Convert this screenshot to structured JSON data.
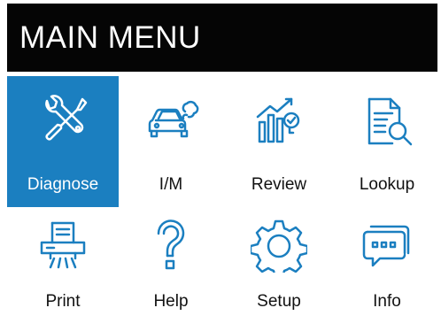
{
  "header": {
    "title": "MAIN MENU"
  },
  "colors": {
    "header_bg": "#050505",
    "accent": "#1b7fc0",
    "icon_color": "#1b7fc0",
    "icon_active": "#ffffff"
  },
  "menu": {
    "items": [
      {
        "label": "Diagnose",
        "icon": "wrench-screwdriver-icon",
        "selected": true
      },
      {
        "label": "I/M",
        "icon": "car-exhaust-icon",
        "selected": false
      },
      {
        "label": "Review",
        "icon": "bar-chart-icon",
        "selected": false
      },
      {
        "label": "Lookup",
        "icon": "document-search-icon",
        "selected": false
      },
      {
        "label": "Print",
        "icon": "printer-icon",
        "selected": false
      },
      {
        "label": "Help",
        "icon": "question-mark-icon",
        "selected": false
      },
      {
        "label": "Setup",
        "icon": "gear-icon",
        "selected": false
      },
      {
        "label": "Info",
        "icon": "message-icon",
        "selected": false
      }
    ]
  }
}
